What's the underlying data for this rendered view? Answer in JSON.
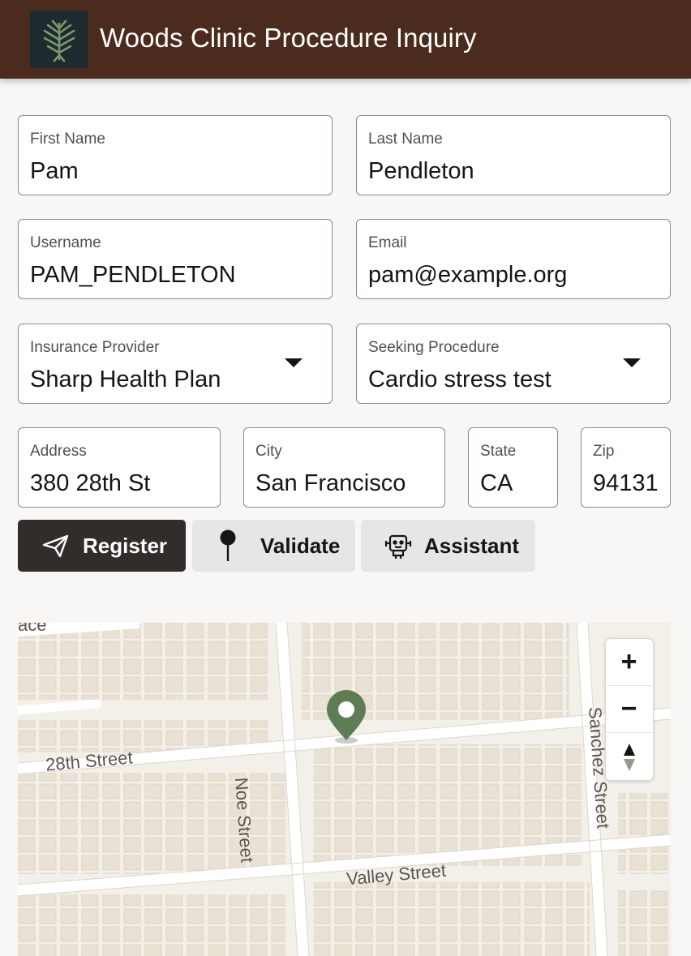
{
  "header": {
    "title": "Woods Clinic Procedure Inquiry",
    "logo_icon": "tree-logo-icon",
    "background": "#4b2b1d"
  },
  "form": {
    "first_name": {
      "label": "First Name",
      "value": "Pam"
    },
    "last_name": {
      "label": "Last Name",
      "value": "Pendleton"
    },
    "username": {
      "label": "Username",
      "value": "PAM_PENDLETON"
    },
    "email": {
      "label": "Email",
      "value": "pam@example.org"
    },
    "insurance": {
      "label": "Insurance Provider",
      "value": "Sharp Health Plan"
    },
    "procedure": {
      "label": "Seeking Procedure",
      "value": "Cardio stress test"
    },
    "address": {
      "label": "Address",
      "value": "380 28th St"
    },
    "city": {
      "label": "City",
      "value": "San Francisco"
    },
    "state": {
      "label": "State",
      "value": "CA"
    },
    "zip": {
      "label": "Zip",
      "value": "94131"
    }
  },
  "actions": {
    "register": {
      "label": "Register",
      "icon": "send-icon"
    },
    "validate": {
      "label": "Validate",
      "icon": "map-pin-icon"
    },
    "assistant": {
      "label": "Assistant",
      "icon": "robot-icon"
    }
  },
  "map": {
    "streets": {
      "top_left_partial": "ace",
      "twenty_eighth": "28th Street",
      "noe": "Noe Street",
      "sanchez": "Sanchez Street",
      "valley": "Valley Street"
    },
    "controls": {
      "zoom_in": "+",
      "zoom_out": "−",
      "compass_icon": "compass-icon"
    },
    "marker_icon": "map-marker-icon",
    "marker_color": "#5e7d55"
  }
}
